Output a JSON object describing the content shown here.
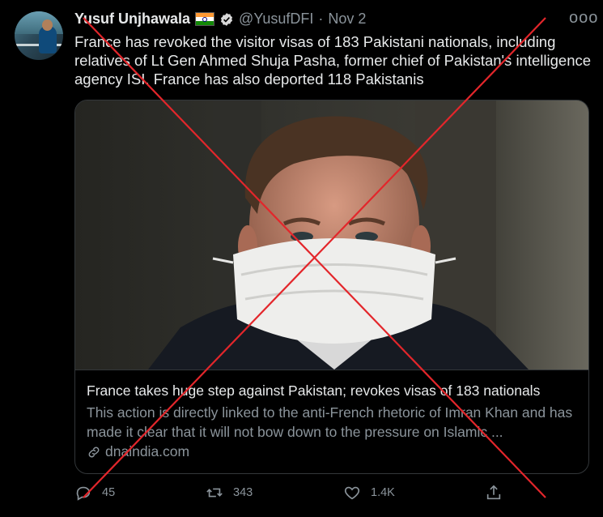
{
  "tweet": {
    "author_name": "Yusuf Unjhawala",
    "handle": "@YusufDFI",
    "separator": "·",
    "date": "Nov 2",
    "more_label": "ooo",
    "text": "France has revoked the visitor visas of 183 Pakistani nationals, including relatives of Lt Gen Ahmed Shuja Pasha, former chief of Pakistan's intelligence agency ISI. France has also deported 118 Pakistanis"
  },
  "card": {
    "title": "France takes huge step against Pakistan; revokes visas of 183 nationals",
    "description": "This action is directly linked to the anti-French rhetoric of Imran Khan and has made it clear that it will not bow down to the pressure on Islamic ...",
    "domain": "dnaindia.com"
  },
  "actions": {
    "reply_count": "45",
    "retweet_count": "343",
    "like_count": "1.4K"
  },
  "colors": {
    "background": "#000000",
    "cross_mark": "#e3262b",
    "verified_badge": "#d9d9d9"
  }
}
